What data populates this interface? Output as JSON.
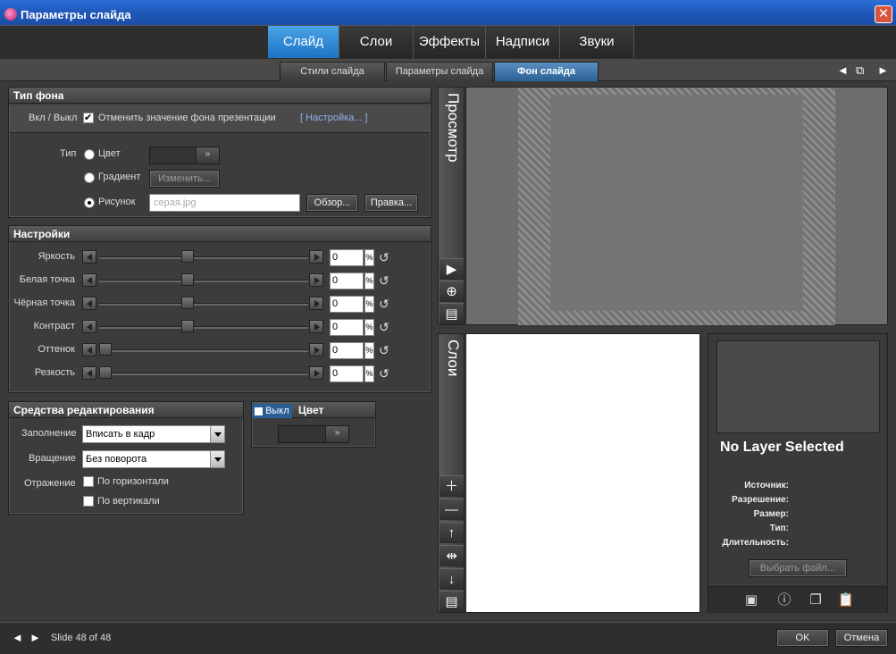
{
  "window": {
    "title": "Параметры слайда",
    "close_glyph": "✕"
  },
  "main_tabs": [
    {
      "label": "Слайд",
      "active": true
    },
    {
      "label": "Слои",
      "active": false
    },
    {
      "label": "Эффекты",
      "active": false
    },
    {
      "label": "Надписи",
      "active": false
    },
    {
      "label": "Звуки",
      "active": false
    }
  ],
  "sub_tabs": [
    {
      "label": "Стили слайда",
      "active": false
    },
    {
      "label": "Параметры слайда",
      "active": false
    },
    {
      "label": "Фон слайда",
      "active": true
    }
  ],
  "nav": {
    "prev": "◄",
    "restore": "⧉",
    "next": "►"
  },
  "background_type": {
    "title": "Тип фона",
    "onoff_label": "Вкл / Выкл",
    "override_label": "Отменить значение фона презентации",
    "override_checked": true,
    "settings_link": "[ Настройка... ]",
    "type_label": "Тип",
    "color_label": "Цвет",
    "gradient_label": "Градиент",
    "gradient_button": "Изменить...",
    "image_label": "Рисунок",
    "selected": "image",
    "file_value": "серая.jpg",
    "browse_button": "Обзор...",
    "edit_button": "Правка..."
  },
  "settings": {
    "title": "Настройки",
    "rows": [
      {
        "label": "Яркость",
        "value": "0",
        "fraction": 0.5
      },
      {
        "label": "Белая точка",
        "value": "0",
        "fraction": 0.5
      },
      {
        "label": "Чёрная точка",
        "value": "0",
        "fraction": 0.5
      },
      {
        "label": "Контраст",
        "value": "0",
        "fraction": 0.5
      },
      {
        "label": "Оттенок",
        "value": "0",
        "fraction": 0.0
      },
      {
        "label": "Резкость",
        "value": "0",
        "fraction": 0.0
      }
    ],
    "unit": "%"
  },
  "editing": {
    "title": "Средства редактирования",
    "fill_label": "Заполнение",
    "fill_value": "Вписать в кадр",
    "rotation_label": "Вращение",
    "rotation_value": "Без поворота",
    "mirror_label": "Отражение",
    "horizontal_label": "По горизонтали",
    "vertical_label": "По вертикали"
  },
  "color_panel": {
    "toggle_label": "Выкл",
    "title": "Цвет"
  },
  "preview": {
    "title": "Просмотр"
  },
  "layers": {
    "title": "Слои"
  },
  "layer_info": {
    "no_selection": "No Layer Selected",
    "source_label": "Источник:",
    "resolution_label": "Разрешение:",
    "size_label": "Размер:",
    "type_label": "Тип:",
    "duration_label": "Длительность:",
    "select_file_button": "Выбрать файл..."
  },
  "footer": {
    "slide_counter": "Slide 48 of 48",
    "ok_button": "OK",
    "cancel_button": "Отмена"
  }
}
